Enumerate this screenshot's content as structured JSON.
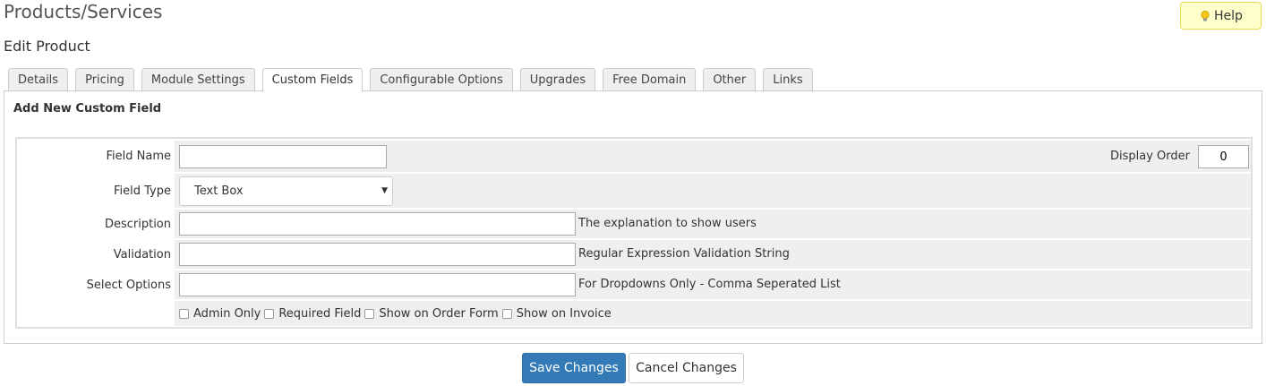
{
  "header": {
    "page_title": "Products/Services",
    "help_label": "Help",
    "subtitle": "Edit Product"
  },
  "tabs": [
    {
      "label": "Details"
    },
    {
      "label": "Pricing"
    },
    {
      "label": "Module Settings"
    },
    {
      "label": "Custom Fields",
      "active": true
    },
    {
      "label": "Configurable Options"
    },
    {
      "label": "Upgrades"
    },
    {
      "label": "Free Domain"
    },
    {
      "label": "Other"
    },
    {
      "label": "Links"
    }
  ],
  "form": {
    "section_title": "Add New Custom Field",
    "field_name_label": "Field Name",
    "field_name_value": "",
    "display_order_label": "Display Order",
    "display_order_value": "0",
    "field_type_label": "Field Type",
    "field_type_value": "Text Box",
    "description_label": "Description",
    "description_hint": "The explanation to show users",
    "validation_label": "Validation",
    "validation_hint": "Regular Expression Validation String",
    "select_options_label": "Select Options",
    "select_options_hint": "For Dropdowns Only - Comma Seperated List",
    "checkboxes": [
      {
        "label": "Admin Only",
        "checked": false
      },
      {
        "label": "Required Field",
        "checked": false
      },
      {
        "label": "Show on Order Form",
        "checked": false
      },
      {
        "label": "Show on Invoice",
        "checked": false
      }
    ]
  },
  "actions": {
    "save_label": "Save Changes",
    "cancel_label": "Cancel Changes"
  },
  "colors": {
    "primary_button": "#337ab7",
    "help_button_bg": "#ffffcc",
    "row_background": "#efefef"
  },
  "icons": {
    "help": "lightbulb-icon",
    "select": "caret-down-icon"
  }
}
